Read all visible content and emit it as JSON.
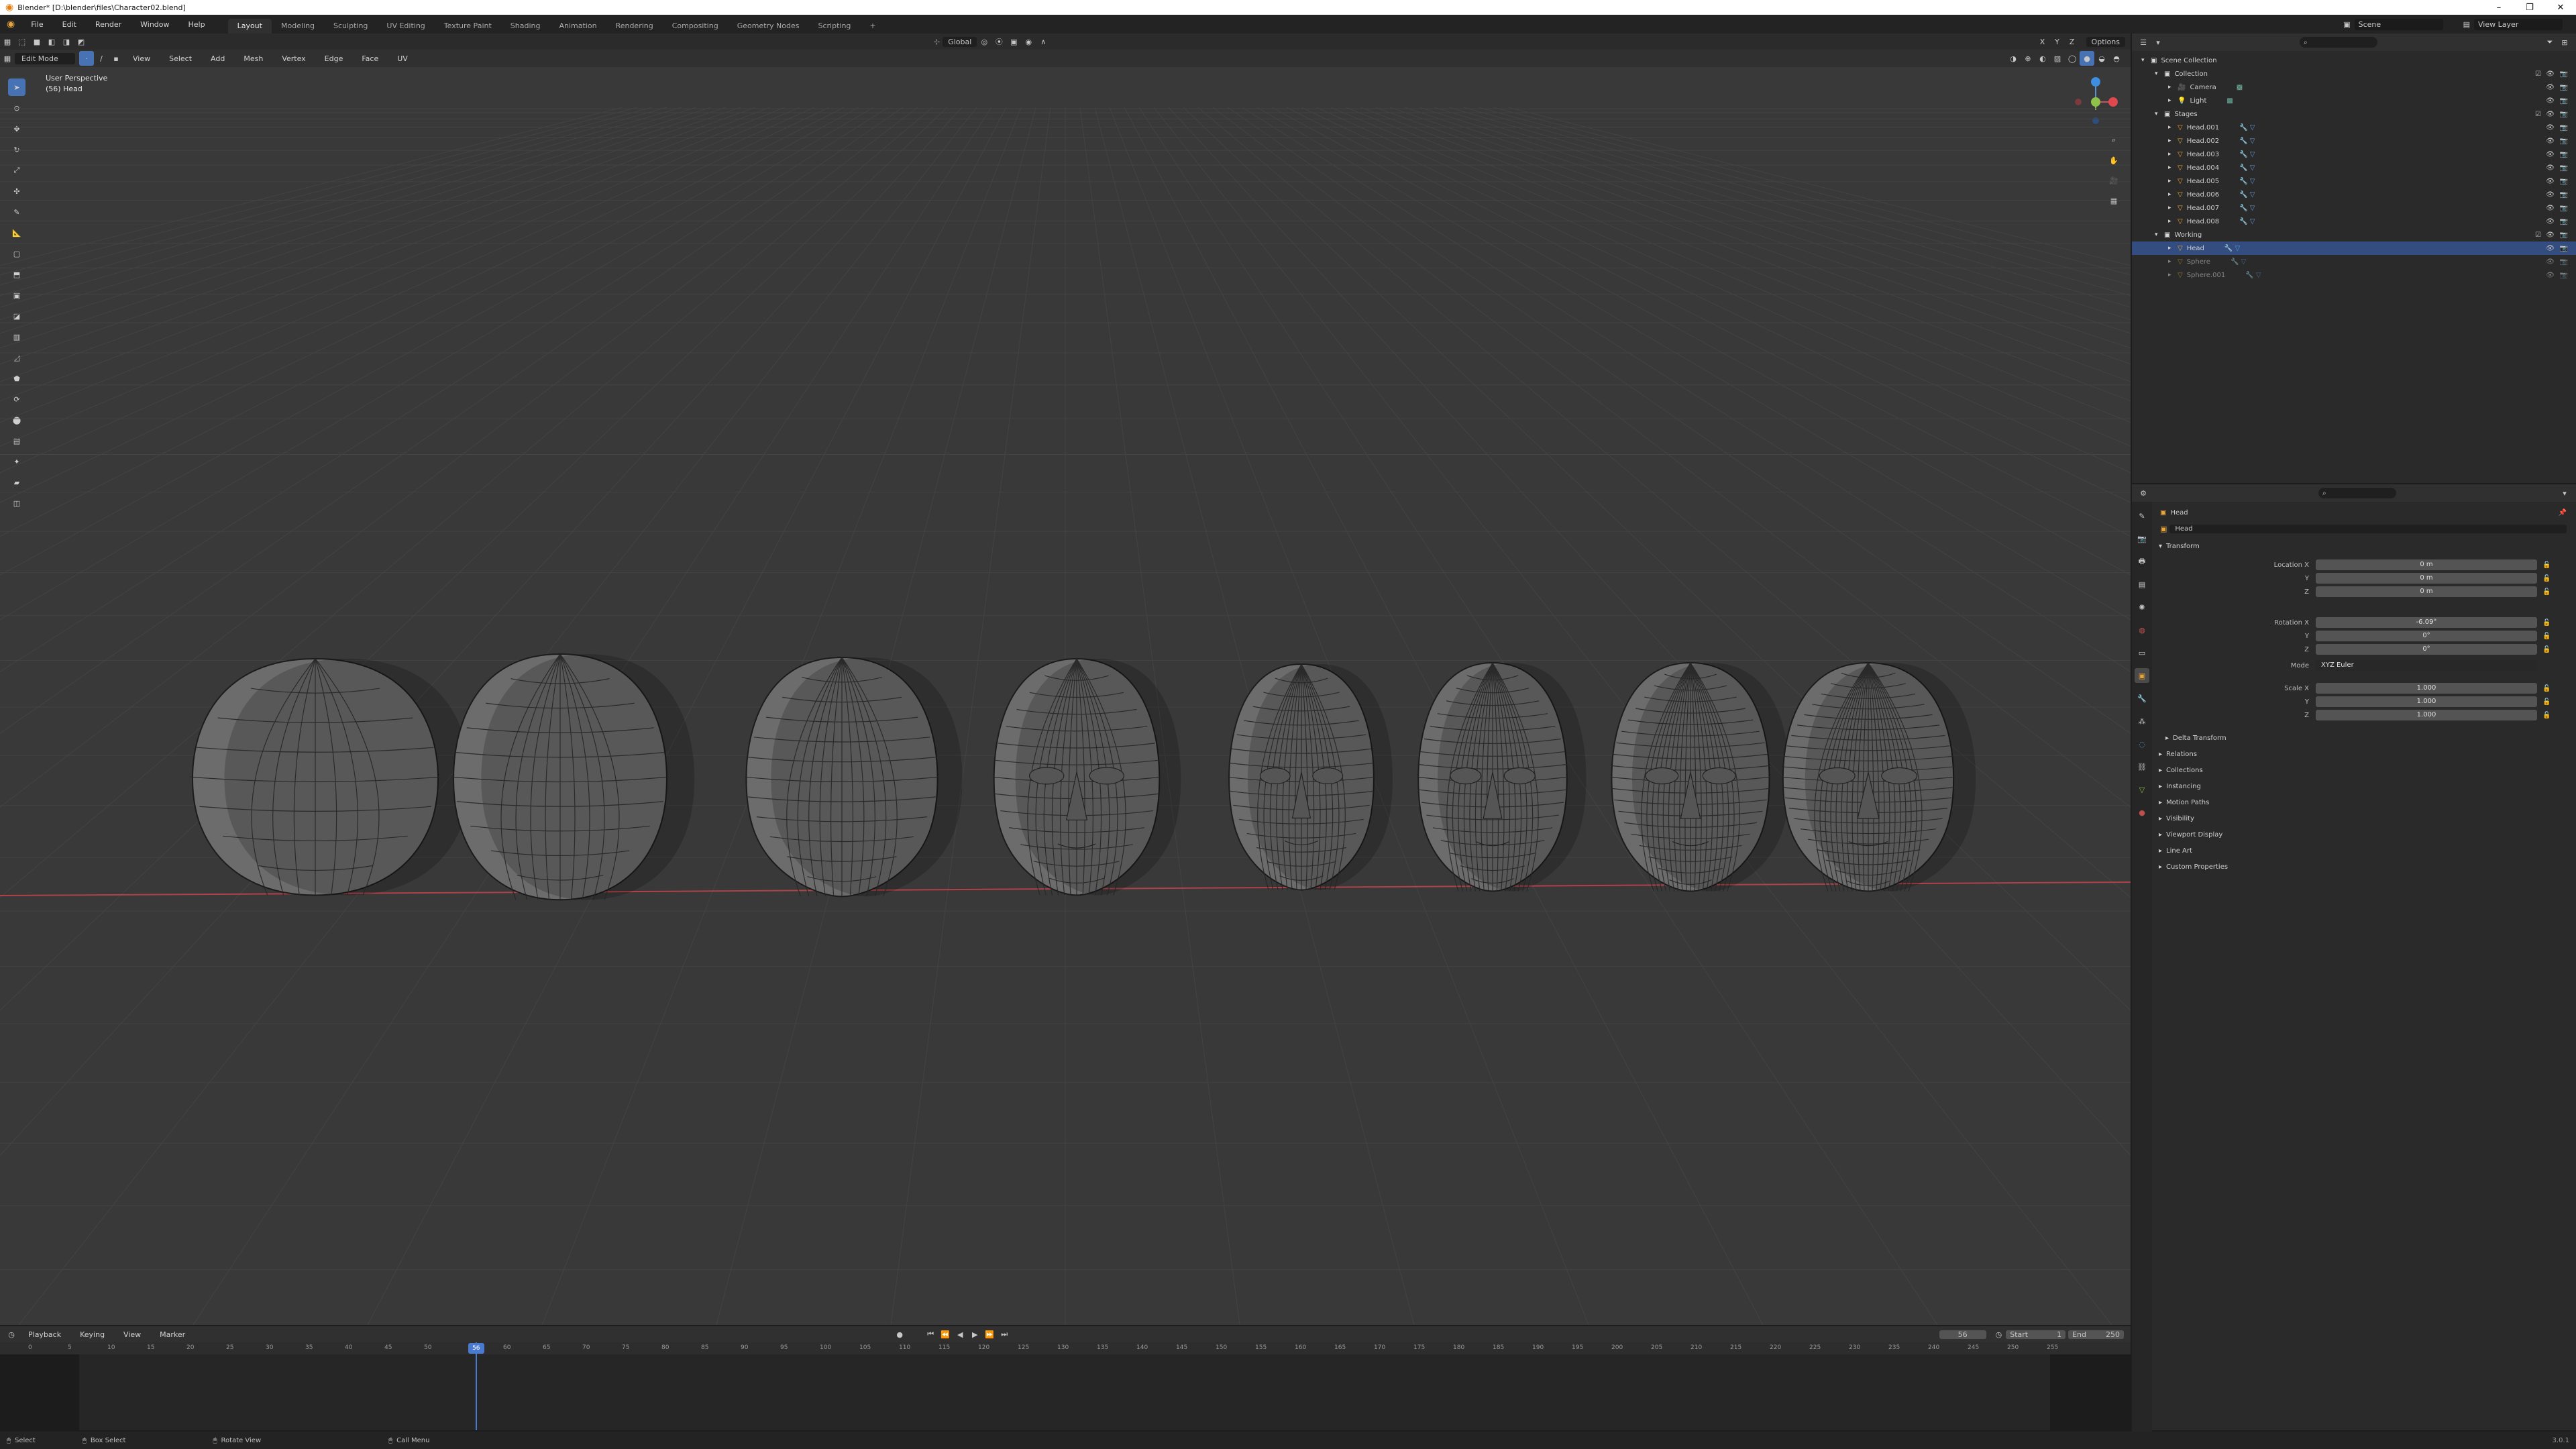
{
  "window": {
    "title": "Blender* [D:\\blender\\files\\Character02.blend]",
    "controls": [
      "–",
      "❐",
      "✕"
    ]
  },
  "topbar": {
    "menus": [
      "File",
      "Edit",
      "Render",
      "Window",
      "Help"
    ],
    "workspaces": [
      "Layout",
      "Modeling",
      "Sculpting",
      "UV Editing",
      "Texture Paint",
      "Shading",
      "Animation",
      "Rendering",
      "Compositing",
      "Geometry Nodes",
      "Scripting"
    ],
    "active_workspace": "Layout",
    "add_workspace": "+",
    "scene": "Scene",
    "view_layer": "View Layer"
  },
  "header": {
    "mode": "Edit Mode",
    "menus": [
      "View",
      "Select",
      "Add",
      "Mesh",
      "Vertex",
      "Edge",
      "Face",
      "UV"
    ],
    "orientation": "Global",
    "options": "Options"
  },
  "viewport": {
    "info_line1": "User Perspective",
    "info_line2": "(56) Head",
    "accent_x": "#e0474f",
    "accent_y": "#8fc24a",
    "accent_z": "#3d8de0",
    "gizmo_labels": {
      "x": "X",
      "y": "Y",
      "z": "Z"
    }
  },
  "outliner": {
    "search_placeholder": "",
    "rows": [
      {
        "label": "Scene Collection",
        "indent": 0,
        "kind": "collection"
      },
      {
        "label": "Collection",
        "indent": 1,
        "kind": "collection"
      },
      {
        "label": "Camera",
        "indent": 2,
        "kind": "camera"
      },
      {
        "label": "Light",
        "indent": 2,
        "kind": "light"
      },
      {
        "label": "Stages",
        "indent": 1,
        "kind": "collection"
      },
      {
        "label": "Head.001",
        "indent": 2,
        "kind": "mesh"
      },
      {
        "label": "Head.002",
        "indent": 2,
        "kind": "mesh"
      },
      {
        "label": "Head.003",
        "indent": 2,
        "kind": "mesh"
      },
      {
        "label": "Head.004",
        "indent": 2,
        "kind": "mesh"
      },
      {
        "label": "Head.005",
        "indent": 2,
        "kind": "mesh"
      },
      {
        "label": "Head.006",
        "indent": 2,
        "kind": "mesh"
      },
      {
        "label": "Head.007",
        "indent": 2,
        "kind": "mesh"
      },
      {
        "label": "Head.008",
        "indent": 2,
        "kind": "mesh"
      },
      {
        "label": "Working",
        "indent": 1,
        "kind": "collection"
      },
      {
        "label": "Head",
        "indent": 2,
        "kind": "mesh",
        "selected": true
      },
      {
        "label": "Sphere",
        "indent": 2,
        "kind": "mesh",
        "dim": true
      },
      {
        "label": "Sphere.001",
        "indent": 2,
        "kind": "mesh",
        "dim": true
      }
    ]
  },
  "properties": {
    "object_name": "Head",
    "object_field": "Head",
    "transform_title": "Transform",
    "location": {
      "label_x": "Location X",
      "label_y": "Y",
      "label_z": "Z",
      "x": "0 m",
      "y": "0 m",
      "z": "0 m"
    },
    "rotation": {
      "label_x": "Rotation X",
      "label_y": "Y",
      "label_z": "Z",
      "x": "-6.09°",
      "y": "0°",
      "z": "0°"
    },
    "mode_label": "Mode",
    "mode_value": "XYZ Euler",
    "scale": {
      "label_x": "Scale X",
      "label_y": "Y",
      "label_z": "Z",
      "x": "1.000",
      "y": "1.000",
      "z": "1.000"
    },
    "delta_transform": "Delta Transform",
    "panels": [
      "Relations",
      "Collections",
      "Instancing",
      "Motion Paths",
      "Visibility",
      "Viewport Display",
      "Line Art",
      "Custom Properties"
    ]
  },
  "timeline": {
    "menus": [
      "Playback",
      "Keying",
      "View",
      "Marker"
    ],
    "current_frame": "56",
    "start_label": "Start",
    "start": "1",
    "end_label": "End",
    "end": "250",
    "ticks": [
      "0",
      "5",
      "10",
      "15",
      "20",
      "25",
      "30",
      "35",
      "40",
      "45",
      "50",
      "56",
      "60",
      "65",
      "70",
      "75",
      "80",
      "85",
      "90",
      "95",
      "100",
      "105",
      "110",
      "115",
      "120",
      "125",
      "130",
      "135",
      "140",
      "145",
      "150",
      "155",
      "160",
      "165",
      "170",
      "175",
      "180",
      "185",
      "190",
      "195",
      "200",
      "205",
      "210",
      "215",
      "220",
      "225",
      "230",
      "235",
      "240",
      "245",
      "250",
      "255"
    ]
  },
  "statusbar": {
    "items": [
      "Select",
      "Box Select",
      "Rotate View",
      "Call Menu"
    ],
    "version": "3.0.1"
  },
  "heads": [
    {
      "stage": 1
    },
    {
      "stage": 2
    },
    {
      "stage": 3
    },
    {
      "stage": 4
    },
    {
      "stage": 5
    },
    {
      "stage": 6
    },
    {
      "stage": 7
    },
    {
      "stage": 8
    }
  ]
}
